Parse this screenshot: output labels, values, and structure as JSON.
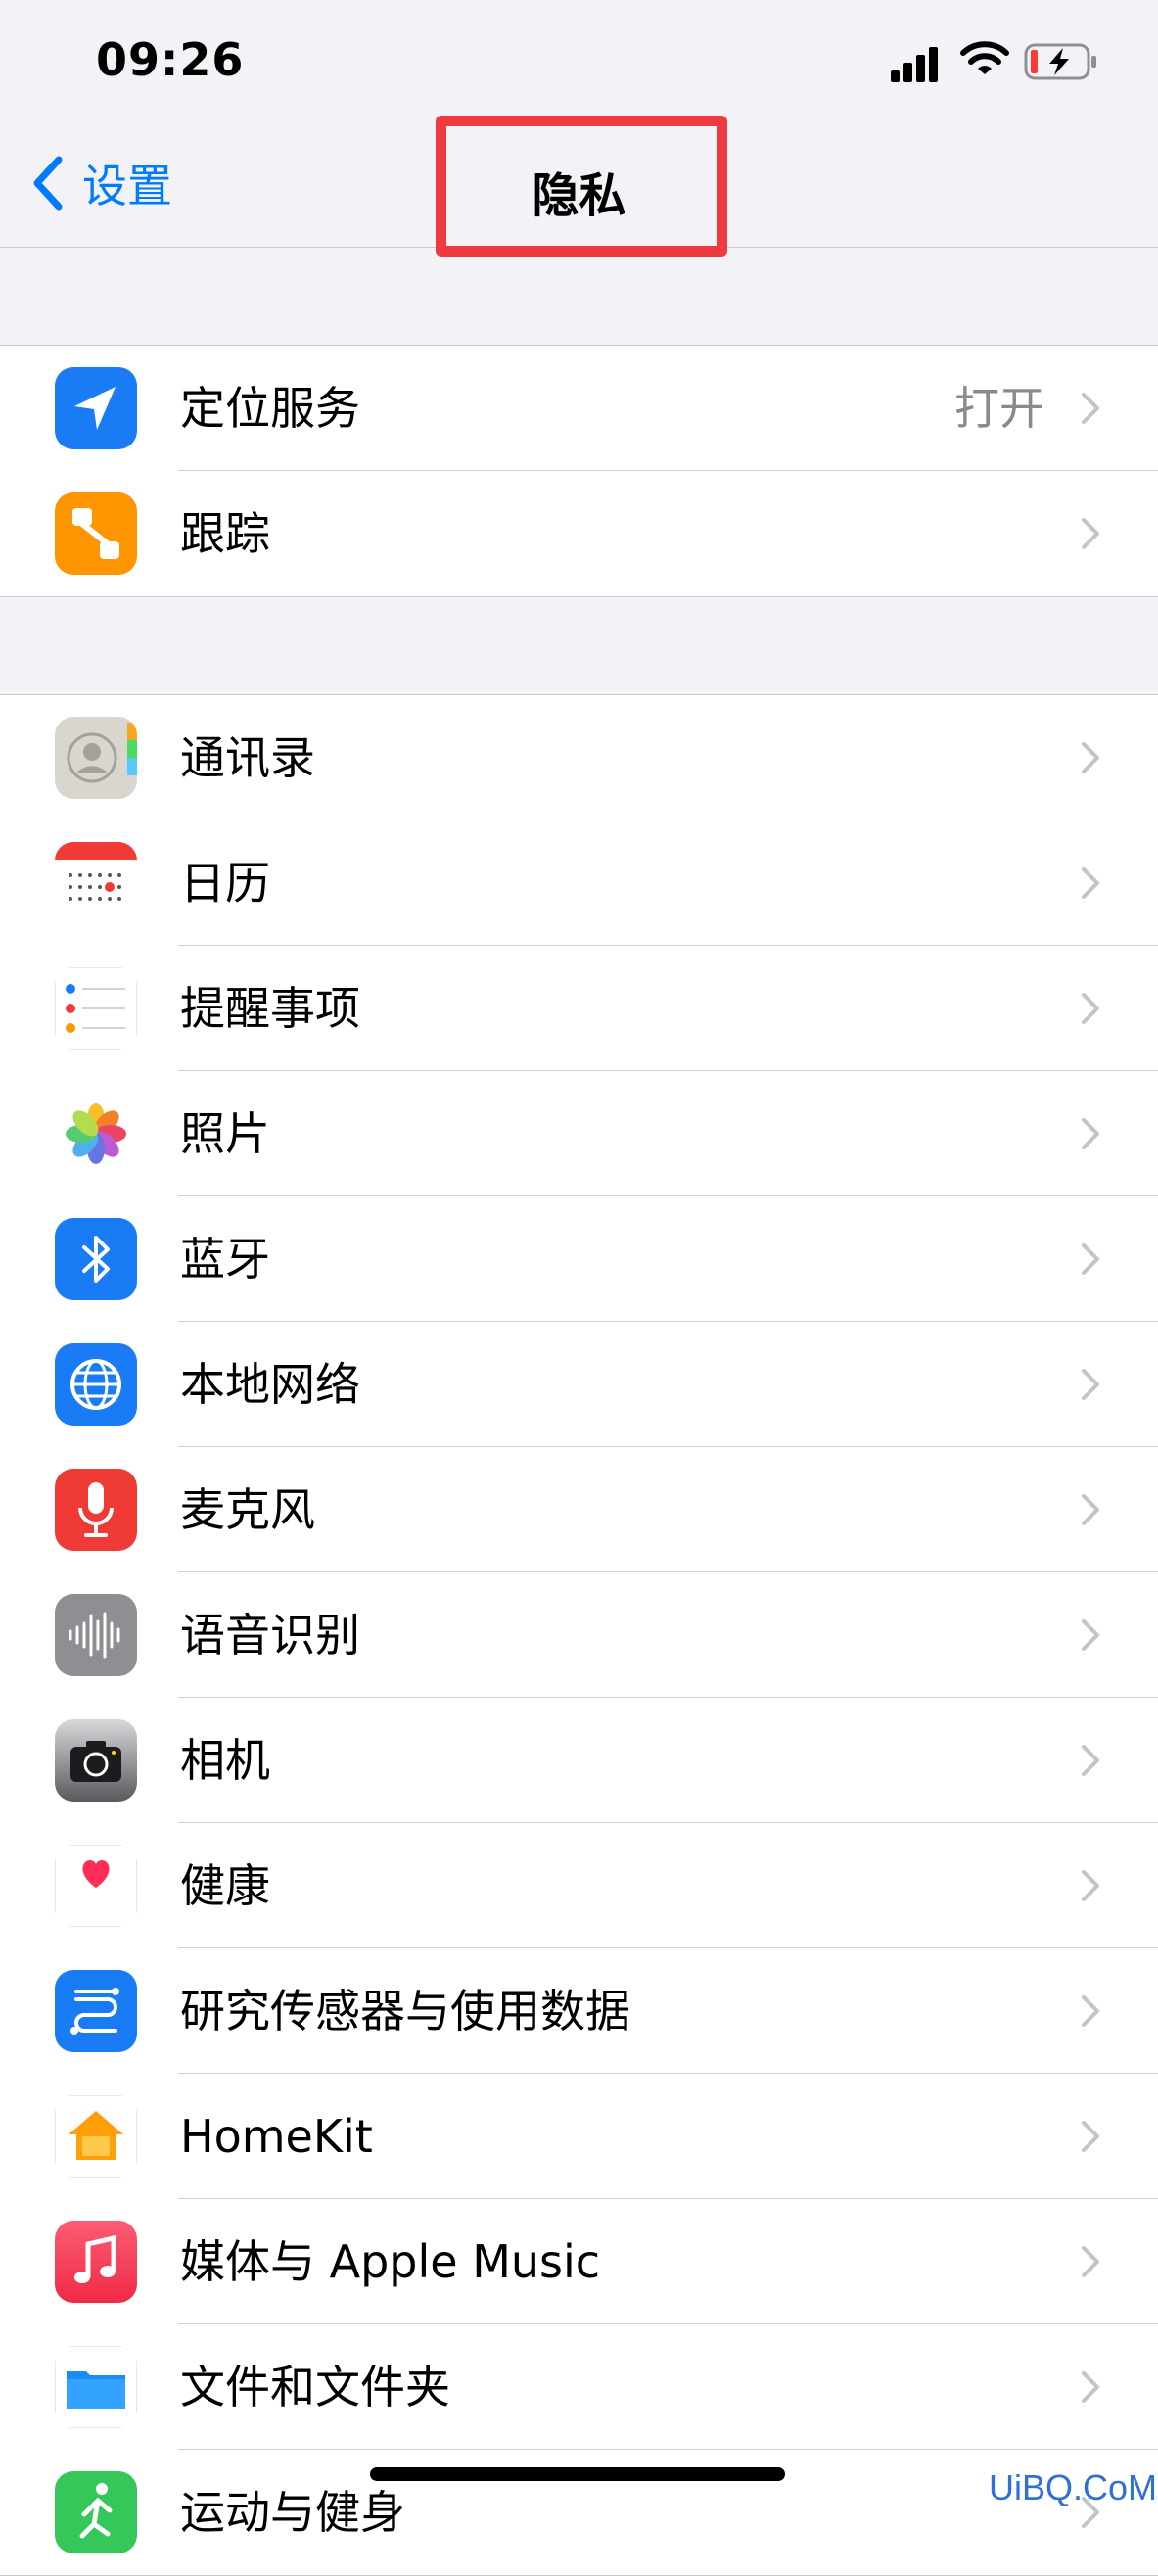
{
  "status_bar": {
    "time": "09:26",
    "battery_state": "charging-low"
  },
  "nav": {
    "back_label": "设置",
    "title": "隐私"
  },
  "group1": [
    {
      "label": "定位服务",
      "value": "打开",
      "icon": "location-arrow-icon",
      "icon_color": "#1a7cf5"
    },
    {
      "label": "跟踪",
      "value": "",
      "icon": "tracking-icon",
      "icon_color": "#ff9500"
    }
  ],
  "group2": [
    {
      "label": "通讯录",
      "icon": "contacts-icon"
    },
    {
      "label": "日历",
      "icon": "calendar-icon"
    },
    {
      "label": "提醒事项",
      "icon": "reminders-icon"
    },
    {
      "label": "照片",
      "icon": "photos-icon"
    },
    {
      "label": "蓝牙",
      "icon": "bluetooth-icon",
      "icon_color": "#1a7cf5"
    },
    {
      "label": "本地网络",
      "icon": "globe-icon",
      "icon_color": "#1a7cf5"
    },
    {
      "label": "麦克风",
      "icon": "microphone-icon",
      "icon_color": "#f03a35"
    },
    {
      "label": "语音识别",
      "icon": "waveform-icon",
      "icon_color": "#8e8e93"
    },
    {
      "label": "相机",
      "icon": "camera-icon",
      "icon_color": "#5a5a5e"
    },
    {
      "label": "健康",
      "icon": "heart-icon",
      "icon_color": "#ff2d55"
    },
    {
      "label": "研究传感器与使用数据",
      "icon": "research-icon",
      "icon_color": "#1a7cf5"
    },
    {
      "label": "HomeKit",
      "icon": "home-icon",
      "icon_color": "#ff9f0a"
    },
    {
      "label": "媒体与 Apple Music",
      "icon": "music-note-icon",
      "icon_color": "#fa3e5e"
    },
    {
      "label": "文件和文件夹",
      "icon": "folder-icon",
      "icon_color": "#1a8cf5"
    },
    {
      "label": "运动与健身",
      "icon": "fitness-icon",
      "icon_color": "#34c759"
    }
  ],
  "watermark": "UiBQ.CoM"
}
